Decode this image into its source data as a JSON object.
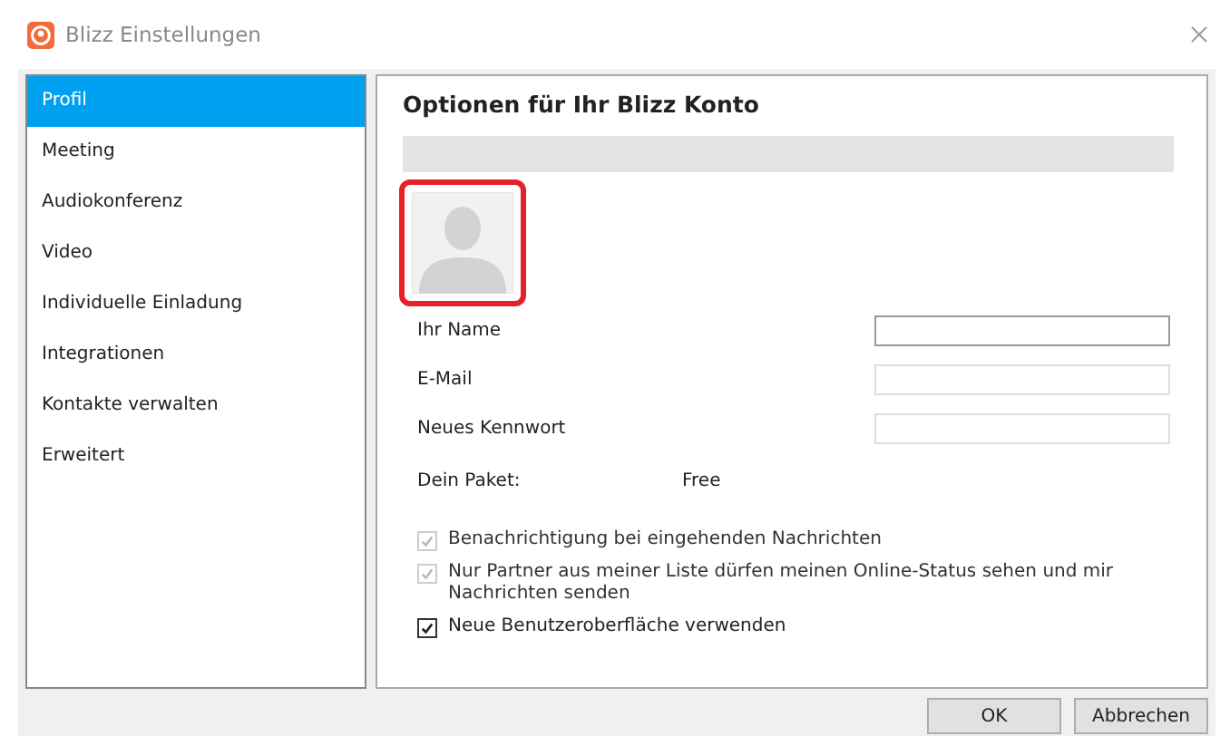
{
  "window": {
    "title": "Blizz Einstellungen"
  },
  "sidebar": {
    "items": [
      {
        "label": "Profil",
        "selected": true
      },
      {
        "label": "Meeting",
        "selected": false
      },
      {
        "label": "Audiokonferenz",
        "selected": false
      },
      {
        "label": "Video",
        "selected": false
      },
      {
        "label": "Individuelle Einladung",
        "selected": false
      },
      {
        "label": "Integrationen",
        "selected": false
      },
      {
        "label": "Kontakte verwalten",
        "selected": false
      },
      {
        "label": "Erweitert",
        "selected": false
      }
    ]
  },
  "panel": {
    "title": "Optionen für Ihr Blizz Konto",
    "avatar": {
      "highlighted": true
    },
    "fields": [
      {
        "label": "Ihr Name",
        "focused": true
      },
      {
        "label": "E-Mail",
        "focused": false
      },
      {
        "label": "Neues Kennwort",
        "focused": false
      }
    ],
    "package": {
      "label": "Dein Paket:",
      "value": "Free"
    },
    "options": [
      {
        "label": "Benachrichtigung bei eingehenden Nachrichten",
        "checked": true,
        "disabled": true
      },
      {
        "label": "Nur Partner aus meiner Liste dürfen meinen Online-Status sehen und mir Nachrichten senden",
        "checked": true,
        "disabled": true
      },
      {
        "label": "Neue Benutzeroberfläche verwenden",
        "checked": true,
        "disabled": false
      }
    ]
  },
  "buttons": [
    "OK",
    "Abbrechen"
  ]
}
